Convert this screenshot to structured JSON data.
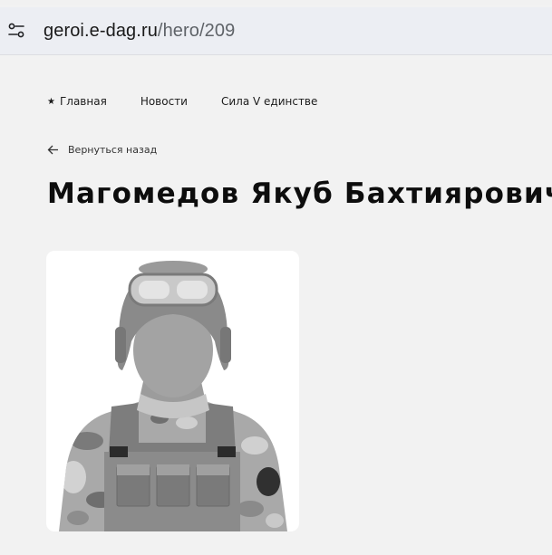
{
  "browser": {
    "url_host": "geroi.e-dag.ru",
    "url_path": "/hero/209",
    "site_info_icon": "tune-icon"
  },
  "nav": {
    "items": [
      {
        "label": "Главная",
        "icon": "star-icon"
      },
      {
        "label": "Новости"
      },
      {
        "label": "Сила V единстве"
      }
    ]
  },
  "back_link": {
    "label": "Вернуться назад",
    "icon": "arrow-left-icon"
  },
  "hero": {
    "name": "Магомедов Якуб Бахтиярович",
    "photo_icon": "soldier-silhouette-icon"
  },
  "colors": {
    "page_bg": "#f2f2f2",
    "card_bg": "#ffffff",
    "text": "#111111",
    "address_bar_bg": "#eceef3"
  }
}
